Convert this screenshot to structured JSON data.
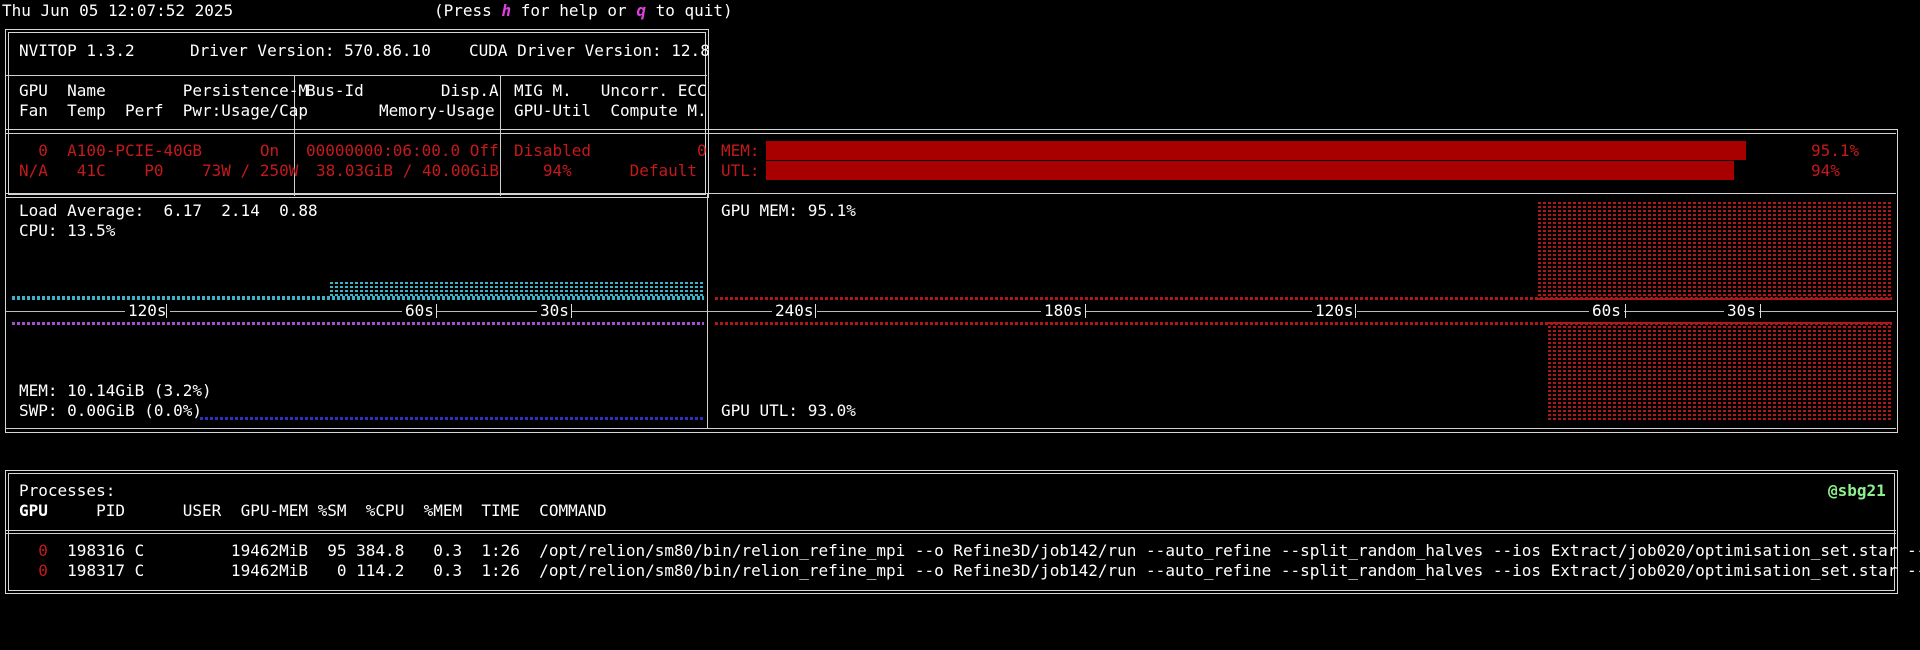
{
  "header": {
    "datetime": "Thu Jun 05 12:07:52 2025",
    "help_prefix": "(Press ",
    "help_key": "h",
    "help_mid": " for help or ",
    "quit_key": "q",
    "help_suffix": " to quit)"
  },
  "info": {
    "nvitop": "NVITOP 1.3.2",
    "driver": "Driver Version: 570.86.10",
    "cuda": "CUDA Driver Version: 12.8"
  },
  "gpu_table": {
    "col1_h1": "GPU  Name        Persistence-M",
    "col1_h2": "Fan  Temp  Perf  Pwr:Usage/Cap",
    "col2_h1": "Bus-Id        Disp.A",
    "col2_h2": "Memory-Usage",
    "col3_h1": "MIG M.   Uncorr. ECC",
    "col3_h2": "GPU-Util  Compute M.",
    "row": {
      "c1_l1": "  0  A100-PCIE-40GB      On",
      "c1_l2": "N/A   41C    P0    73W / 250W",
      "c2_l1": "00000000:06:00.0 Off",
      "c2_l2": "38.03GiB / 40.00GiB",
      "c3_l1": "Disabled           0",
      "c3_l2": "   94%      Default"
    },
    "mem_label": "MEM:",
    "utl_label": "UTL:",
    "mem_pct": "95.1%",
    "utl_pct": "94%",
    "mem_fraction": 0.951,
    "utl_fraction": 0.94,
    "bar_color": "#a80000"
  },
  "host": {
    "load_average": "Load Average:  6.17  2.14  0.88",
    "cpu": "CPU: 13.5%",
    "mem": "MEM: 10.14GiB (3.2%)",
    "swp": "SWP: 0.00GiB (0.0%)",
    "axis_labels": [
      "120s",
      "60s",
      "30s"
    ]
  },
  "gpu_history": {
    "gpu_mem": "GPU MEM: 95.1%",
    "gpu_utl": "GPU UTL: 93.0%",
    "axis_labels": [
      "240s",
      "180s",
      "120s",
      "60s",
      "30s"
    ]
  },
  "processes": {
    "title": "Processes:",
    "user_host": "@sbg21",
    "headers": "GPU     PID      USER  GPU-MEM %SM  %CPU  %MEM  TIME  COMMAND",
    "header_gpu": "GPU",
    "header_rest": "     PID      USER  GPU-MEM %SM  %CPU  %MEM  TIME  COMMAND",
    "rows": [
      {
        "gpu": "  0",
        "rest": "  198316 C         19462MiB  95 384.8   0.3  1:26  /opt/relion/sm80/bin/relion_refine_mpi --o Refine3D/job142/run --auto_refine --split_random_halves --ios Extract/job020/optimisation_set.star --sigma_t.."
      },
      {
        "gpu": "  0",
        "rest": "  198317 C         19462MiB   0 114.2   0.3  1:26  /opt/relion/sm80/bin/relion_refine_mpi --o Refine3D/job142/run --auto_refine --split_random_halves --ios Extract/job020/optimisation_set.star --sigma_t.."
      }
    ]
  }
}
